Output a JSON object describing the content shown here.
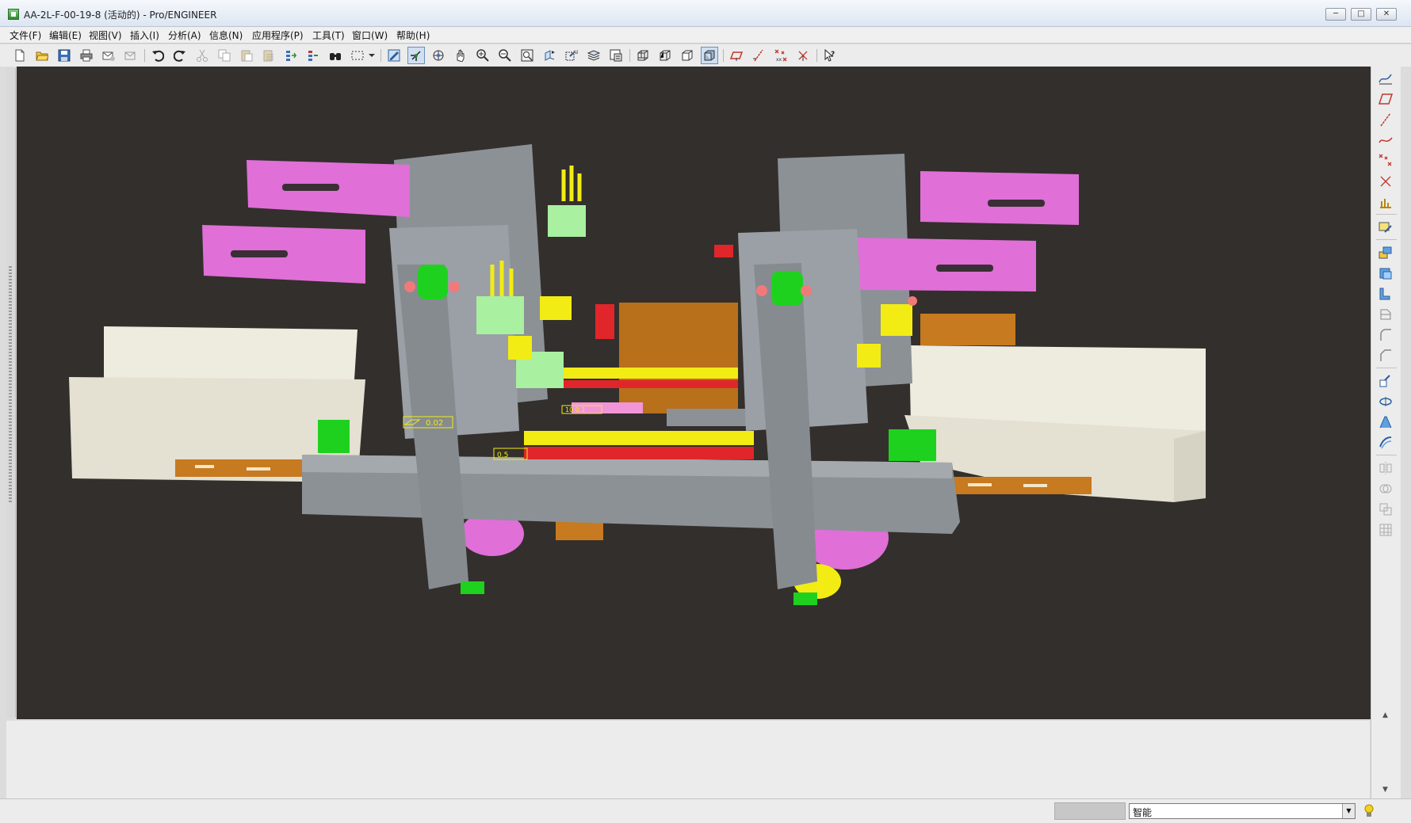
{
  "window": {
    "title": "AA-2L-F-00-19-8 (活动的) - Pro/ENGINEER",
    "minimize_label": "─",
    "maximize_label": "□",
    "close_label": "✕"
  },
  "menu": [
    {
      "label": "文件(F)"
    },
    {
      "label": "编辑(E)"
    },
    {
      "label": "视图(V)"
    },
    {
      "label": "插入(I)"
    },
    {
      "label": "分析(A)"
    },
    {
      "label": "信息(N)"
    },
    {
      "label": "应用程序(P)"
    },
    {
      "label": "工具(T)"
    },
    {
      "label": "窗口(W)"
    },
    {
      "label": "帮助(H)"
    }
  ],
  "toolbar_icons": [
    "new-icon",
    "open-icon",
    "save-icon",
    "print-icon",
    "send-mail-icon",
    "send-mail-alt-icon",
    "undo-icon",
    "redo-icon",
    "cut-icon",
    "copy-icon",
    "paste-icon",
    "paste-special-icon",
    "regenerate-icon",
    "regen-manager-icon",
    "find-icon",
    "select-box-icon",
    "repaint-icon",
    "spin-center-icon",
    "orient-mode-icon",
    "pan-icon",
    "zoom-in-icon",
    "zoom-out-icon",
    "refit-icon",
    "reorient-icon",
    "saved-views-icon",
    "layers-icon",
    "view-manager-icon",
    "wireframe-icon",
    "hidden-line-icon",
    "no-hidden-icon",
    "shading-icon",
    "datum-planes-icon",
    "datum-axes-icon",
    "datum-points-icon",
    "csys-icon",
    "context-help-icon"
  ],
  "viewport": {
    "background": "#332f2c",
    "annotations": {
      "flatness": "0.02",
      "parallel": "10 0.1",
      "position": "0.5"
    }
  },
  "right_toolbar_icons": [
    "sketch-datum-curve-icon",
    "datum-plane-icon",
    "datum-axis-icon",
    "datum-curve-icon",
    "datum-point-icon",
    "csys-icon",
    "analysis-feature-icon",
    "sketch-tool-icon",
    "extrude-icon",
    "revolve-icon",
    "sweep-icon",
    "blend-icon",
    "round-icon",
    "chamfer-icon",
    "draft-icon",
    "shell-icon",
    "rib-icon",
    "style-icon",
    "mirror-icon",
    "merge-icon",
    "intersect-icon",
    "pattern-icon"
  ],
  "status": {
    "message": "",
    "filter_value": "智能"
  },
  "colors": {
    "model_gray": "#8c9196",
    "magenta": "#e06fd7",
    "green": "#1fd11f",
    "yellow": "#f2ec14",
    "orange": "#c77a1f",
    "light_green": "#a9f0a0",
    "red": "#e0262b",
    "cream": "#eeebdf"
  }
}
